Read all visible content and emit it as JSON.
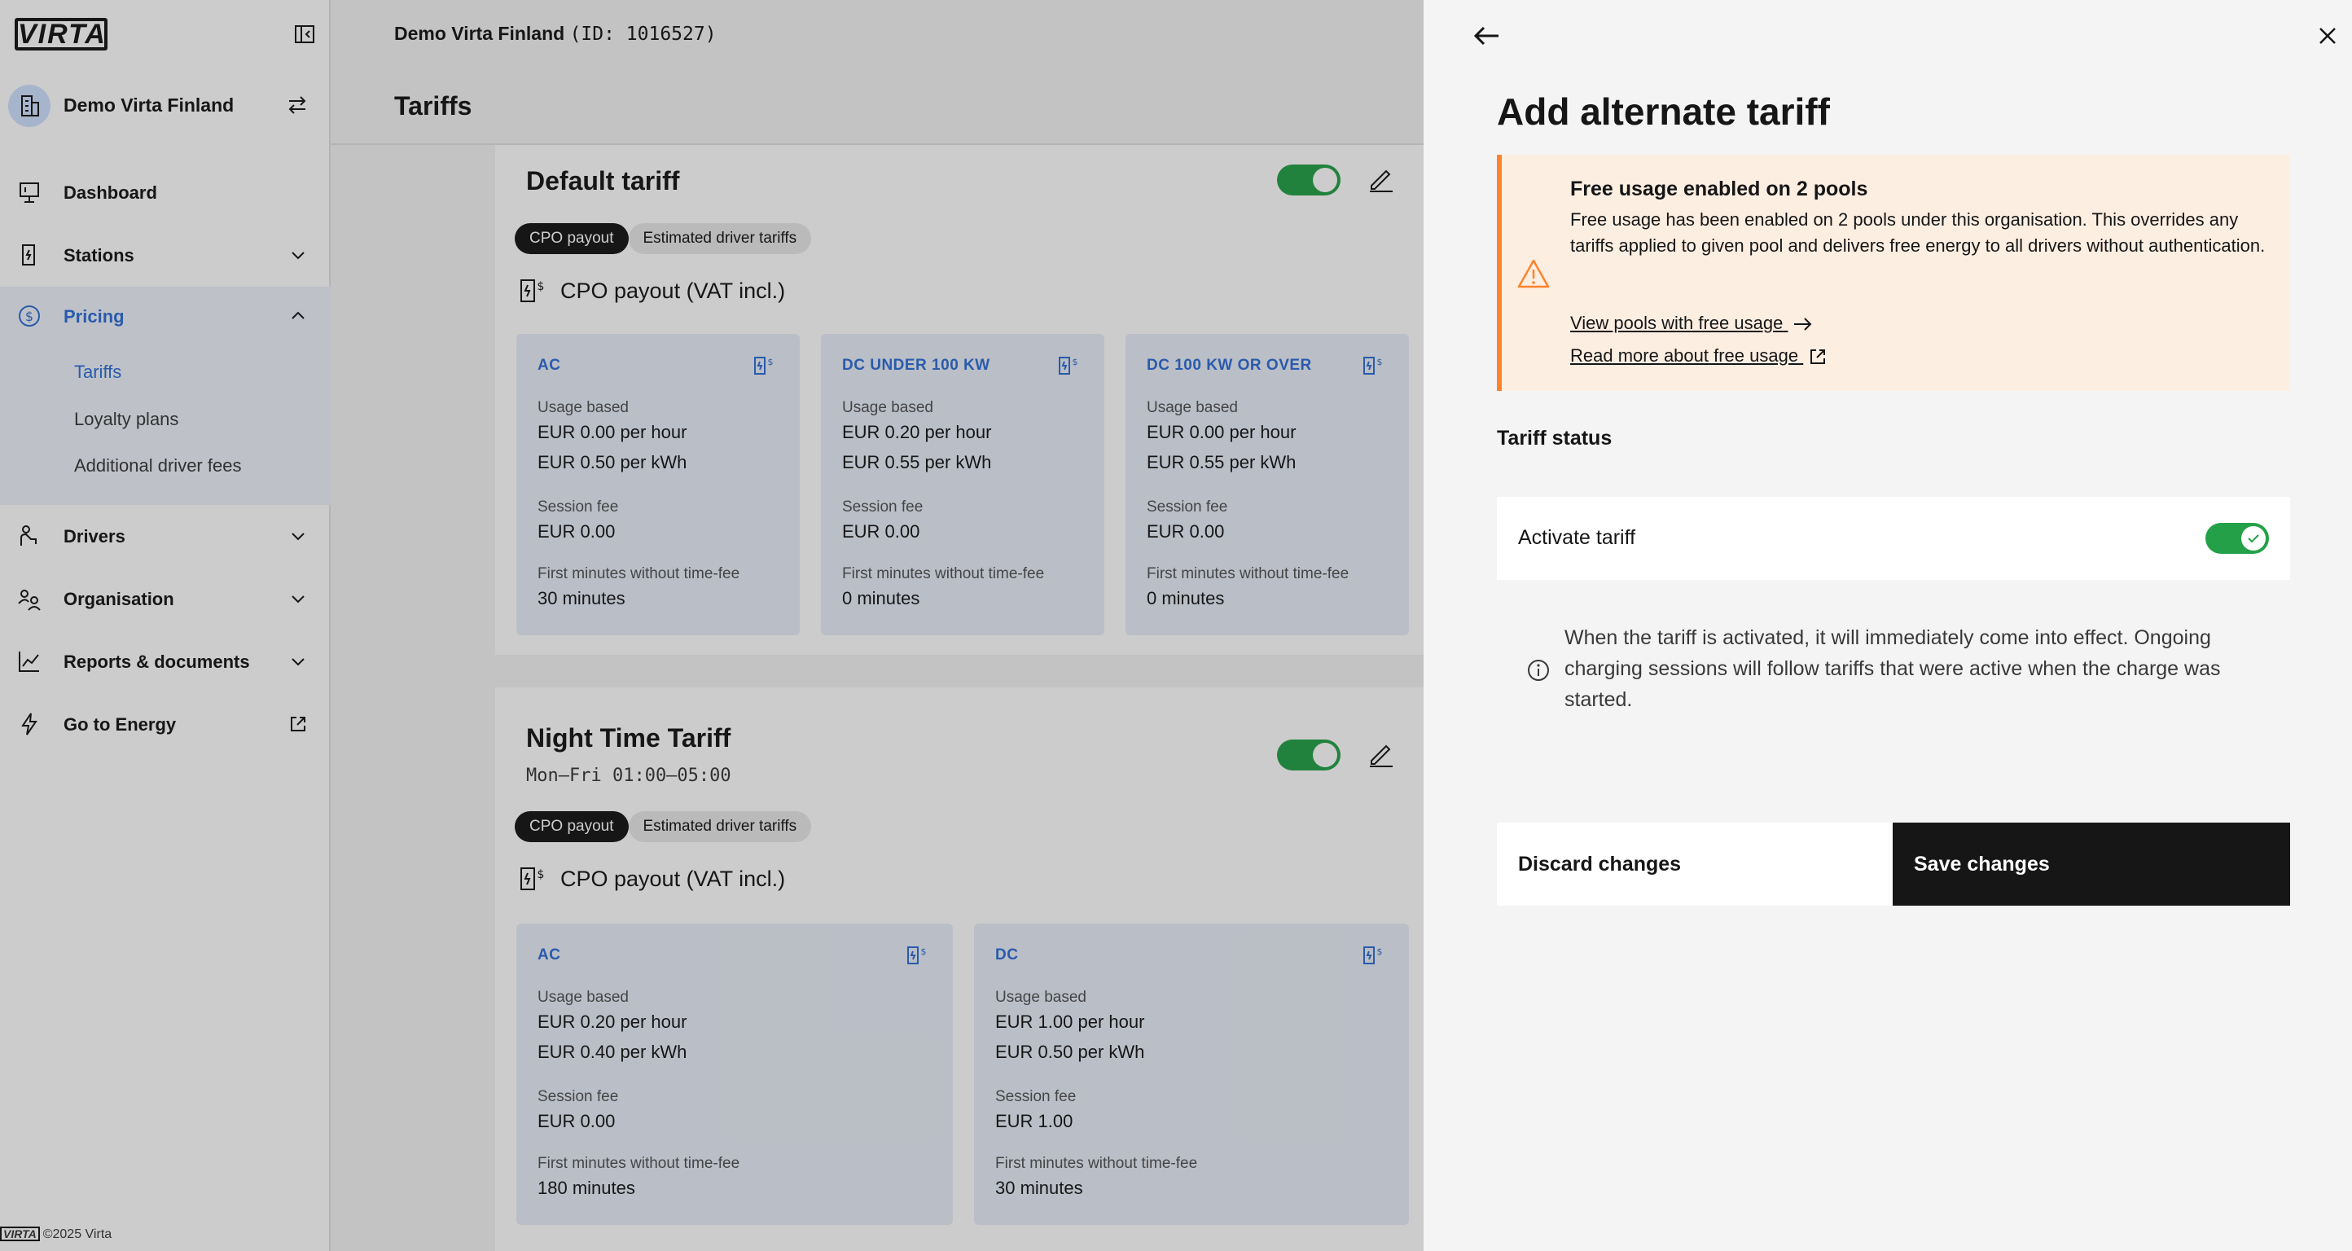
{
  "sidebar": {
    "logo_text": "VIRTA",
    "org_name": "Demo Virta Finland",
    "nav": {
      "dashboard": "Dashboard",
      "stations": "Stations",
      "pricing": "Pricing",
      "drivers": "Drivers",
      "organisation": "Organisation",
      "reports": "Reports & documents",
      "energy": "Go to Energy"
    },
    "pricing_sub": {
      "tariffs": "Tariffs",
      "loyalty": "Loyalty plans",
      "fees": "Additional driver fees"
    },
    "footer_logo": "VIRTA",
    "footer_text": "©2025 Virta"
  },
  "main": {
    "org_name": "Demo Virta Finland",
    "org_id": "(ID: 1016527)",
    "page_title": "Tariffs",
    "tariffs": [
      {
        "title": "Default tariff",
        "schedule": "",
        "active": true,
        "segment_on": "CPO payout",
        "segment_off": "Estimated driver tariffs",
        "payout_heading": "CPO payout (VAT incl.)",
        "cards": [
          {
            "type": "AC",
            "usage_label": "Usage based",
            "per_hour": "EUR 0.00 per hour",
            "per_kwh": "EUR 0.50 per kWh",
            "session_label": "Session fee",
            "session_fee": "EUR 0.00",
            "free_label": "First minutes without time-fee",
            "free_minutes": "30 minutes"
          },
          {
            "type": "DC UNDER 100 KW",
            "usage_label": "Usage based",
            "per_hour": "EUR 0.20 per hour",
            "per_kwh": "EUR 0.55 per kWh",
            "session_label": "Session fee",
            "session_fee": "EUR 0.00",
            "free_label": "First minutes without time-fee",
            "free_minutes": "0 minutes"
          },
          {
            "type": "DC 100 KW OR OVER",
            "usage_label": "Usage based",
            "per_hour": "EUR 0.00 per hour",
            "per_kwh": "EUR 0.55 per kWh",
            "session_label": "Session fee",
            "session_fee": "EUR 0.00",
            "free_label": "First minutes without time-fee",
            "free_minutes": "0 minutes"
          }
        ]
      },
      {
        "title": "Night Time Tariff",
        "schedule": "Mon—Fri 01:00–05:00",
        "active": true,
        "segment_on": "CPO payout",
        "segment_off": "Estimated driver tariffs",
        "payout_heading": "CPO payout (VAT incl.)",
        "cards": [
          {
            "type": "AC",
            "usage_label": "Usage based",
            "per_hour": "EUR 0.20 per hour",
            "per_kwh": "EUR 0.40 per kWh",
            "session_label": "Session fee",
            "session_fee": "EUR 0.00",
            "free_label": "First minutes without time-fee",
            "free_minutes": "180 minutes"
          },
          {
            "type": "DC",
            "usage_label": "Usage based",
            "per_hour": "EUR 1.00 per hour",
            "per_kwh": "EUR 0.50 per kWh",
            "session_label": "Session fee",
            "session_fee": "EUR 1.00",
            "free_label": "First minutes without time-fee",
            "free_minutes": "30 minutes"
          }
        ]
      }
    ]
  },
  "panel": {
    "title": "Add alternate tariff",
    "notice": {
      "title": "Free usage enabled on 2 pools",
      "body": "Free usage has been enabled on 2 pools under this organisation. This overrides any tariffs applied to given pool and delivers free energy to all drivers without authentication.",
      "link_pools": "View pools with free usage",
      "link_read": "Read more about free usage"
    },
    "status_heading": "Tariff status",
    "activate_label": "Activate tariff",
    "activate_on": true,
    "info_text": "When the tariff is activated, it will immediately come into effect. Ongoing charging sessions will follow tariffs that were active when the charge was started.",
    "discard_label": "Discard changes",
    "save_label": "Save changes"
  },
  "colors": {
    "accent_blue": "#2f6fd6",
    "toggle_green": "#24a148",
    "warning_orange": "#ff832b",
    "notice_bg": "#fdeee2",
    "primary_button": "#161616"
  },
  "icons": {
    "collapse": "sidebar-collapse-icon",
    "org": "building-icon",
    "switch": "switch-arrows-icon",
    "dashboard": "presentation-board-icon",
    "stations": "charging-station-icon",
    "pricing": "dollar-circle-icon",
    "drivers": "driver-icon",
    "organisation": "user-group-icon",
    "reports": "line-chart-icon",
    "energy": "lightning-icon",
    "external": "external-link-icon",
    "edit": "pencil-icon",
    "payout": "charge-payout-icon",
    "card": "tariff-card-icon",
    "warning": "warning-triangle-icon",
    "info": "info-circle-icon",
    "back": "arrow-left-icon",
    "close": "close-icon"
  }
}
